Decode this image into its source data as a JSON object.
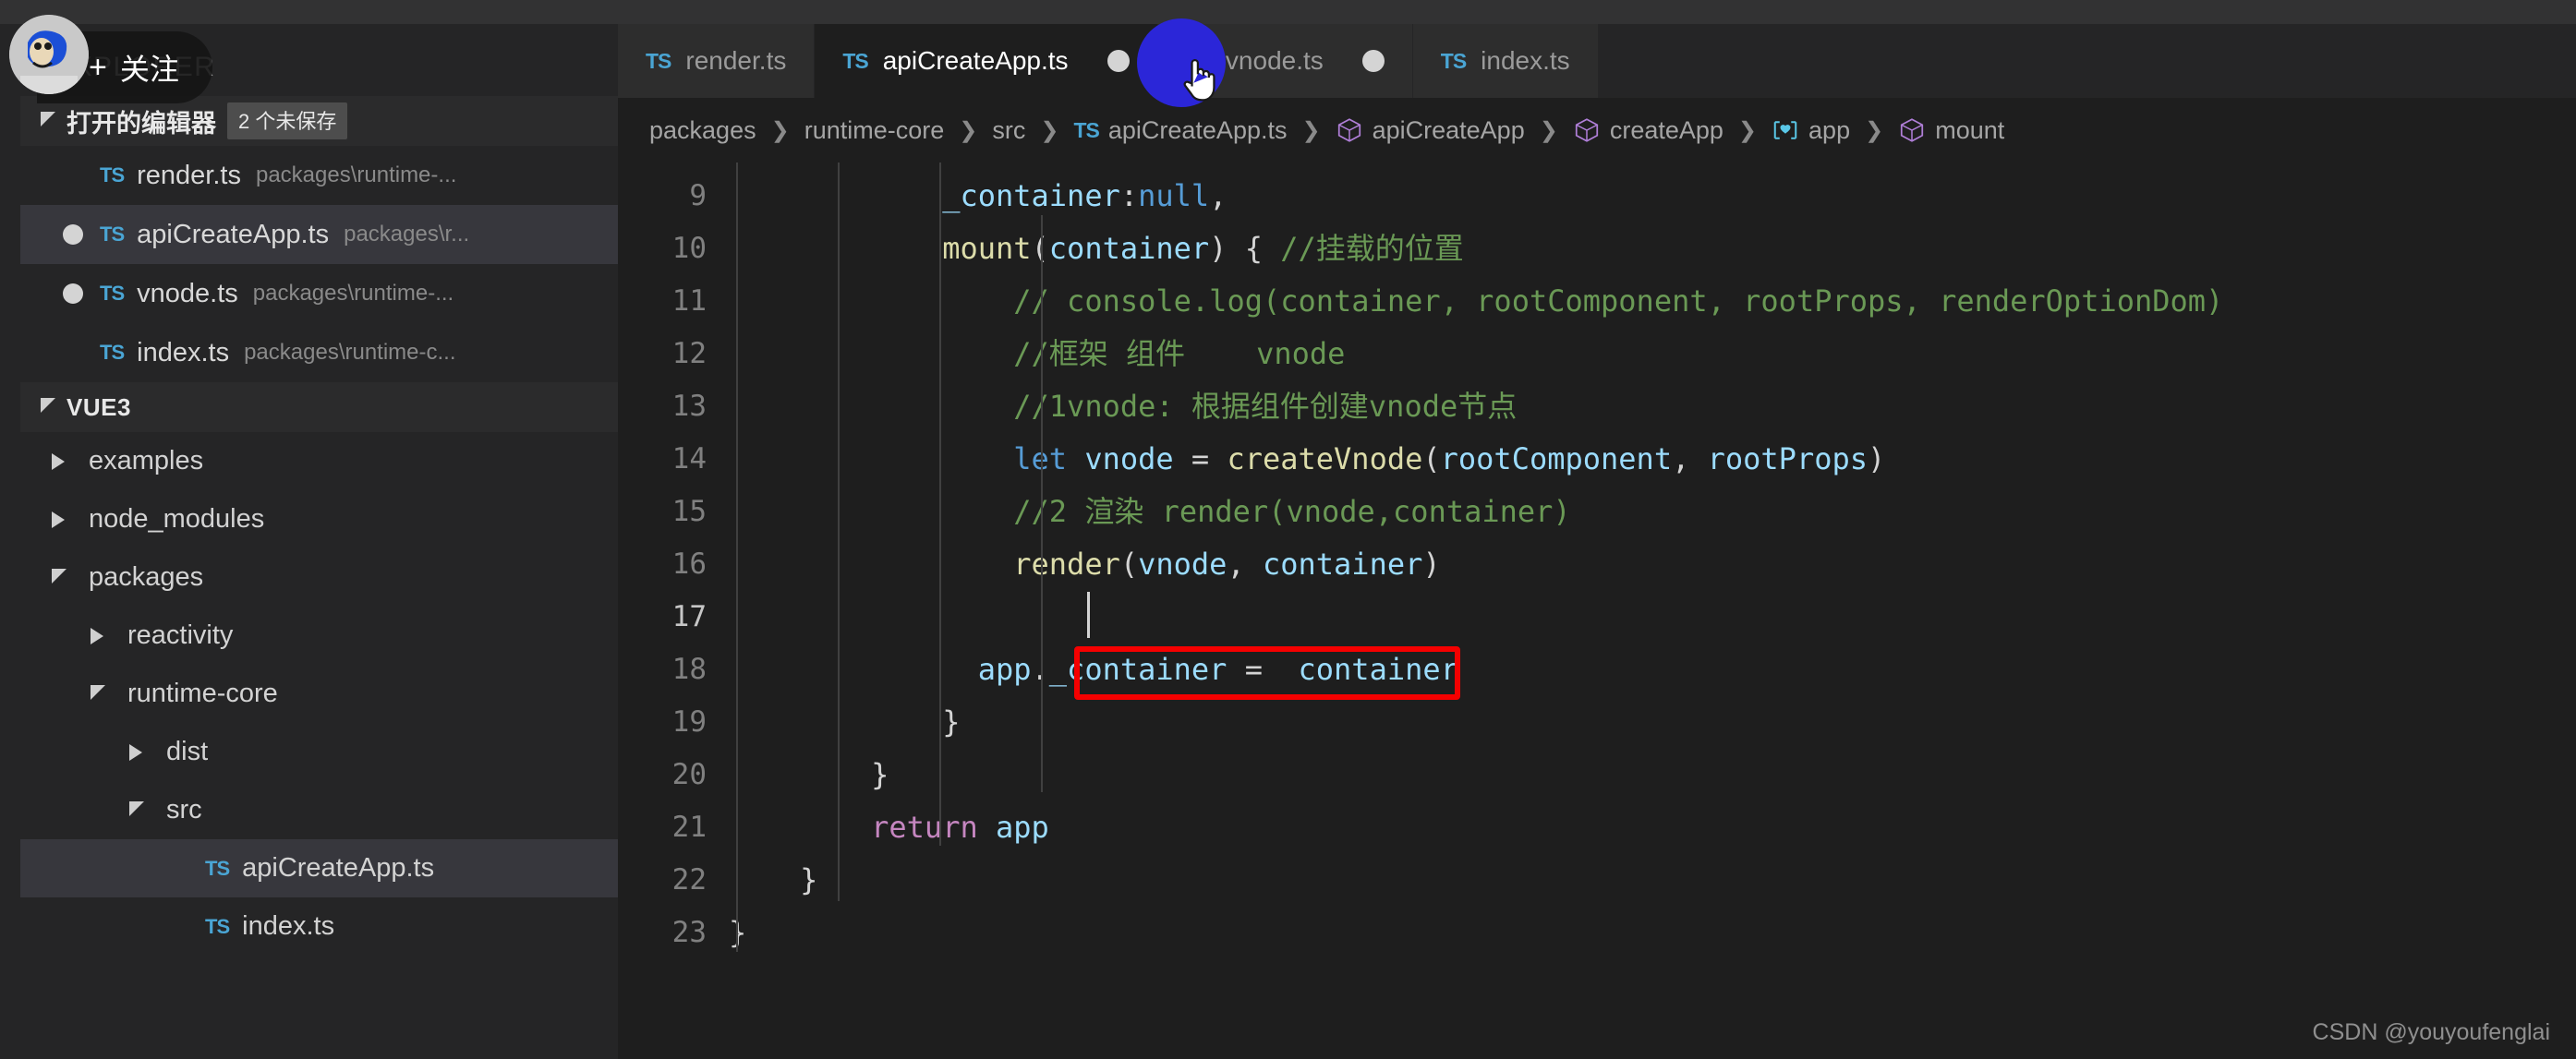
{
  "window": {
    "menubar_fragment": "",
    "watermark": "CSDN @youyoufenglai"
  },
  "overlay": {
    "follow_plus": "+",
    "follow_label": "关注"
  },
  "sidebar": {
    "title": "EXPLORER",
    "open_editors": {
      "label": "打开的编辑器",
      "badge": "2 个未保存",
      "items": [
        {
          "icon": "ts-file-icon",
          "name": "render.ts",
          "path": "packages\\runtime-...",
          "dirty": false,
          "selected": false
        },
        {
          "icon": "ts-file-icon",
          "name": "apiCreateApp.ts",
          "path": "packages\\r...",
          "dirty": true,
          "selected": true
        },
        {
          "icon": "ts-file-icon",
          "name": "vnode.ts",
          "path": "packages\\runtime-...",
          "dirty": true,
          "selected": false
        },
        {
          "icon": "ts-file-icon",
          "name": "index.ts",
          "path": "packages\\runtime-c...",
          "dirty": false,
          "selected": false
        }
      ]
    },
    "workspace": {
      "label": "VUE3",
      "tree": [
        {
          "label": "examples",
          "depth": 1,
          "kind": "folder",
          "expanded": false,
          "selected": false
        },
        {
          "label": "node_modules",
          "depth": 1,
          "kind": "folder",
          "expanded": false,
          "selected": false
        },
        {
          "label": "packages",
          "depth": 1,
          "kind": "folder",
          "expanded": true,
          "selected": false
        },
        {
          "label": "reactivity",
          "depth": 2,
          "kind": "folder",
          "expanded": false,
          "selected": false
        },
        {
          "label": "runtime-core",
          "depth": 2,
          "kind": "folder",
          "expanded": true,
          "selected": false
        },
        {
          "label": "dist",
          "depth": 3,
          "kind": "folder",
          "expanded": false,
          "selected": false
        },
        {
          "label": "src",
          "depth": 3,
          "kind": "folder",
          "expanded": true,
          "selected": false
        },
        {
          "label": "apiCreateApp.ts",
          "depth": 4,
          "kind": "ts-file",
          "expanded": false,
          "selected": true
        },
        {
          "label": "index.ts",
          "depth": 4,
          "kind": "ts-file",
          "expanded": false,
          "selected": false
        }
      ]
    }
  },
  "editor": {
    "tabs": [
      {
        "icon": "ts-file-icon",
        "label": "render.ts",
        "dirty": false,
        "active": false
      },
      {
        "icon": "ts-file-icon",
        "label": "apiCreateApp.ts",
        "dirty": true,
        "active": true
      },
      {
        "icon": "ts-file-icon",
        "label": "vnode.ts",
        "dirty": true,
        "active": false
      },
      {
        "icon": "ts-file-icon",
        "label": "index.ts",
        "dirty": false,
        "active": false
      }
    ],
    "breadcrumbs": [
      {
        "label": "packages",
        "icon": "none"
      },
      {
        "label": "runtime-core",
        "icon": "none"
      },
      {
        "label": "src",
        "icon": "none"
      },
      {
        "label": "apiCreateApp.ts",
        "icon": "ts-file-icon"
      },
      {
        "label": "apiCreateApp",
        "icon": "module-cube-icon"
      },
      {
        "label": "createApp",
        "icon": "module-cube-icon"
      },
      {
        "label": "app",
        "icon": "field-icon"
      },
      {
        "label": "mount",
        "icon": "module-cube-icon"
      }
    ],
    "breadcrumb_separator": "❯",
    "line_numbers": [
      "9",
      "10",
      "11",
      "12",
      "13",
      "14",
      "15",
      "16",
      "17",
      "18",
      "19",
      "20",
      "21",
      "22",
      "23"
    ],
    "active_line_number": "17",
    "code_lines": [
      [
        {
          "t": "            ",
          "c": "plain"
        },
        {
          "t": "_container",
          "c": "var"
        },
        {
          "t": ":",
          "c": "punc"
        },
        {
          "t": "null",
          "c": "key"
        },
        {
          "t": ",",
          "c": "punc"
        }
      ],
      [
        {
          "t": "            ",
          "c": "plain"
        },
        {
          "t": "mount",
          "c": "fn"
        },
        {
          "t": "(",
          "c": "punc"
        },
        {
          "t": "container",
          "c": "var"
        },
        {
          "t": ") { ",
          "c": "punc"
        },
        {
          "t": "//挂载的位置",
          "c": "comment"
        }
      ],
      [
        {
          "t": "                ",
          "c": "plain"
        },
        {
          "t": "// console.log(container, rootComponent, rootProps, renderOptionDom)",
          "c": "comment"
        }
      ],
      [
        {
          "t": "                ",
          "c": "plain"
        },
        {
          "t": "//框架 组件    vnode",
          "c": "comment"
        }
      ],
      [
        {
          "t": "                ",
          "c": "plain"
        },
        {
          "t": "//1vnode: 根据组件创建vnode节点",
          "c": "comment"
        }
      ],
      [
        {
          "t": "                ",
          "c": "plain"
        },
        {
          "t": "let",
          "c": "key"
        },
        {
          "t": " ",
          "c": "plain"
        },
        {
          "t": "vnode",
          "c": "var"
        },
        {
          "t": " = ",
          "c": "punc"
        },
        {
          "t": "createVnode",
          "c": "fn"
        },
        {
          "t": "(",
          "c": "punc"
        },
        {
          "t": "rootComponent",
          "c": "var"
        },
        {
          "t": ", ",
          "c": "punc"
        },
        {
          "t": "rootProps",
          "c": "var"
        },
        {
          "t": ")",
          "c": "punc"
        }
      ],
      [
        {
          "t": "                ",
          "c": "plain"
        },
        {
          "t": "//2 渲染 render(vnode,container)",
          "c": "comment"
        }
      ],
      [
        {
          "t": "                ",
          "c": "plain"
        },
        {
          "t": "render",
          "c": "fn"
        },
        {
          "t": "(",
          "c": "punc"
        },
        {
          "t": "vnode",
          "c": "var"
        },
        {
          "t": ", ",
          "c": "punc"
        },
        {
          "t": "container",
          "c": "var"
        },
        {
          "t": ")",
          "c": "punc"
        }
      ],
      [
        {
          "t": "                ",
          "c": "plain"
        }
      ],
      [
        {
          "t": "              ",
          "c": "plain"
        },
        {
          "t": "app",
          "c": "var"
        },
        {
          "t": ".",
          "c": "punc"
        },
        {
          "t": "_container",
          "c": "var"
        },
        {
          "t": " =  ",
          "c": "punc"
        },
        {
          "t": "container",
          "c": "var"
        }
      ],
      [
        {
          "t": "            ",
          "c": "plain"
        },
        {
          "t": "}",
          "c": "punc"
        }
      ],
      [
        {
          "t": "        ",
          "c": "plain"
        },
        {
          "t": "}",
          "c": "punc"
        }
      ],
      [
        {
          "t": "        ",
          "c": "plain"
        },
        {
          "t": "return",
          "c": "key2"
        },
        {
          "t": " ",
          "c": "plain"
        },
        {
          "t": "app",
          "c": "var"
        }
      ],
      [
        {
          "t": "    ",
          "c": "plain"
        },
        {
          "t": "}",
          "c": "punc"
        }
      ],
      [
        {
          "t": "",
          "c": "plain"
        },
        {
          "t": "}",
          "c": "punc"
        }
      ]
    ],
    "annotation_box": {
      "color": "#f50000",
      "target_text": "app._container =  container"
    }
  },
  "colors": {
    "editor_bg": "#1e1e1e",
    "sidebar_bg": "#252526",
    "tab_inactive_bg": "#2d2d2d",
    "selection_bg": "#37373d",
    "comment": "#6a9955",
    "keyword": "#569cd6",
    "function": "#dcdcaa",
    "variable": "#9cdcfe",
    "control_keyword": "#c586c0",
    "ts_icon": "#4aa5d4",
    "annotation_red": "#f50000",
    "cursor_bubble": "#2b26d8"
  }
}
